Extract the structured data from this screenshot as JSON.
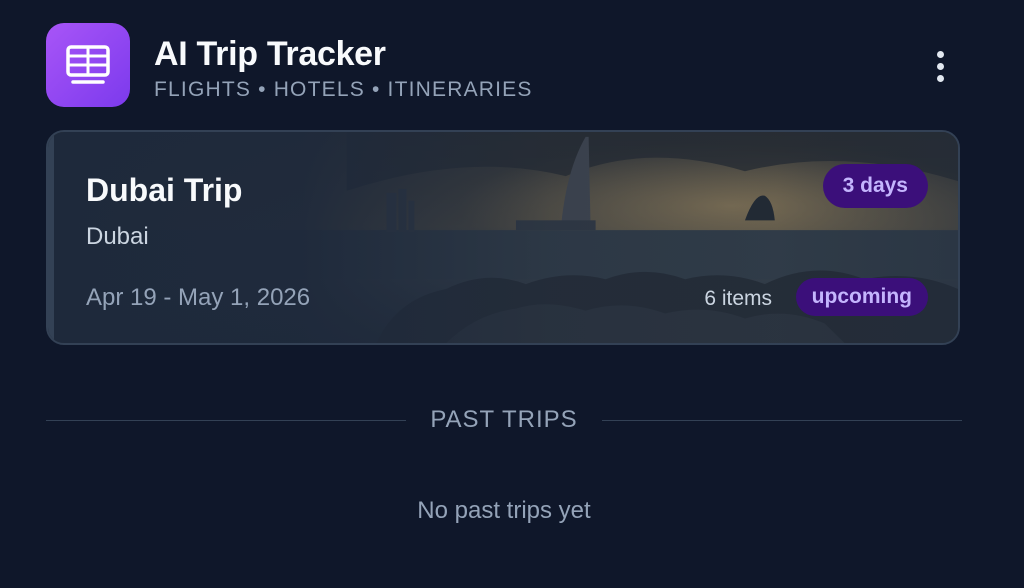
{
  "app": {
    "title": "AI Trip Tracker",
    "subtitle": "FLIGHTS • HOTELS • ITINERARIES",
    "logo_icon": "calendar-grid-icon",
    "menu_icon": "more-vertical-icon",
    "accent_color": "#a855f7"
  },
  "upcoming_trip": {
    "name": "Dubai Trip",
    "destination": "Dubai",
    "dates": "Apr 19 - May 1, 2026",
    "duration_badge": "3 days",
    "items_count": "6 items",
    "status": "upcoming",
    "background_image": "dubai-skyline-sunset-photo"
  },
  "past_trips": {
    "heading": "PAST TRIPS",
    "empty_message": "No past trips yet"
  }
}
